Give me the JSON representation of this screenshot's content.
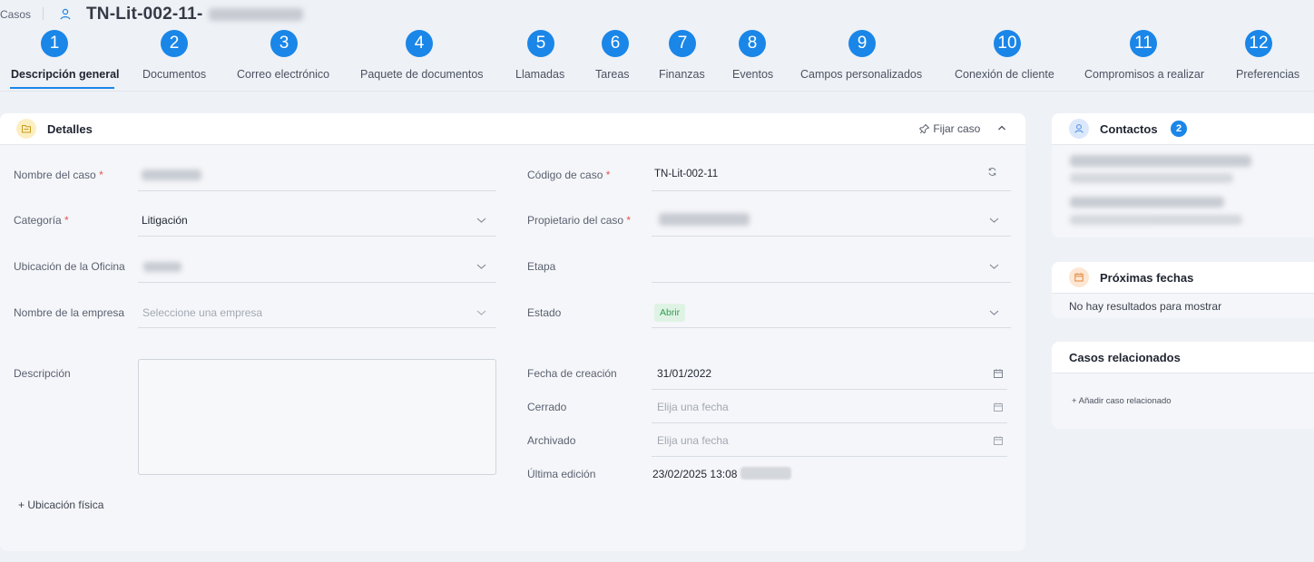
{
  "header": {
    "breadcrumb": "Casos",
    "case_title": "TN-Lit-002-11",
    "dash": "-"
  },
  "tabs": [
    {
      "num": "1",
      "label": "Descripción general",
      "active": true
    },
    {
      "num": "2",
      "label": "Documentos"
    },
    {
      "num": "3",
      "label": "Correo electrónico"
    },
    {
      "num": "4",
      "label": "Paquete de documentos"
    },
    {
      "num": "5",
      "label": "Llamadas"
    },
    {
      "num": "6",
      "label": "Tareas"
    },
    {
      "num": "7",
      "label": "Finanzas"
    },
    {
      "num": "8",
      "label": "Eventos"
    },
    {
      "num": "9",
      "label": "Campos personalizados"
    },
    {
      "num": "10",
      "label": "Conexión de cliente"
    },
    {
      "num": "11",
      "label": "Compromisos a realizar"
    },
    {
      "num": "12",
      "label": "Preferencias"
    }
  ],
  "details": {
    "title": "Detalles",
    "pin_label": "Fijar caso",
    "required_mark": "*",
    "left_fields": {
      "case_name": {
        "label": "Nombre del caso"
      },
      "category": {
        "label": "Categoría",
        "value": "Litigación"
      },
      "office": {
        "label": "Ubicación de la Oficina"
      },
      "company": {
        "label": "Nombre de la empresa",
        "placeholder": "Seleccione una empresa"
      },
      "description": {
        "label": "Descripción"
      }
    },
    "right_fields": {
      "case_code": {
        "label": "Código de caso",
        "value": "TN-Lit-002-11"
      },
      "owner": {
        "label": "Propietario del caso"
      },
      "stage": {
        "label": "Etapa"
      },
      "status": {
        "label": "Estado",
        "value": "Abrir"
      },
      "created": {
        "label": "Fecha de creación",
        "value": "31/01/2022"
      },
      "closed": {
        "label": "Cerrado",
        "placeholder": "Elija una fecha"
      },
      "archived": {
        "label": "Archivado",
        "placeholder": "Elija una fecha"
      },
      "last_edit": {
        "label": "Última edición",
        "value": "23/02/2025 13:08"
      }
    },
    "physical_location": "+ Ubicación física"
  },
  "contacts": {
    "title": "Contactos",
    "count": "2"
  },
  "upcoming": {
    "title": "Próximas fechas",
    "empty": "No hay resultados para mostrar"
  },
  "related": {
    "title": "Casos relacionados",
    "add_label": "+ Añadir caso relacionado"
  },
  "colors": {
    "accent": "#1a86e8",
    "status_green": "#2f9e54",
    "required": "#e25555"
  }
}
